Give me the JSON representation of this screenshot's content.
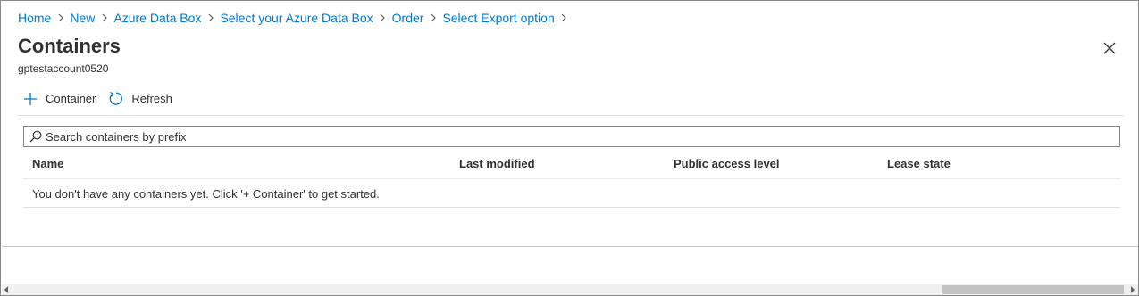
{
  "breadcrumb": [
    {
      "label": "Home"
    },
    {
      "label": "New"
    },
    {
      "label": "Azure Data Box"
    },
    {
      "label": "Select your Azure Data Box"
    },
    {
      "label": "Order"
    },
    {
      "label": "Select Export option"
    }
  ],
  "header": {
    "title": "Containers",
    "subtitle": "gptestaccount0520"
  },
  "toolbar": {
    "add_container_label": "Container",
    "refresh_label": "Refresh"
  },
  "search": {
    "placeholder": "Search containers by prefix"
  },
  "table": {
    "columns": [
      "Name",
      "Last modified",
      "Public access level",
      "Lease state"
    ],
    "empty_message": "You don't have any containers yet. Click '+ Container' to get started."
  },
  "colors": {
    "link": "#0078d4",
    "text": "#323130",
    "border": "#8a8886"
  },
  "icons": [
    "chevron-right-icon",
    "close-icon",
    "plus-icon",
    "refresh-icon",
    "search-icon"
  ]
}
